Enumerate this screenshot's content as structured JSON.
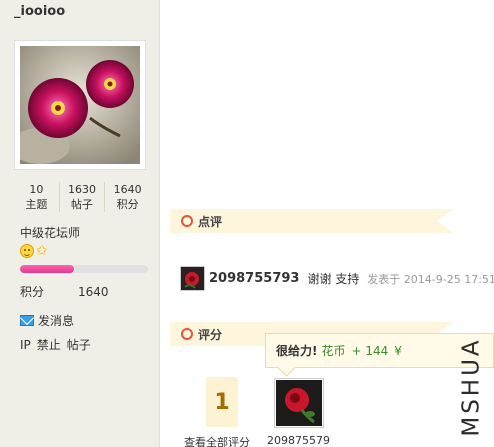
{
  "profile": {
    "username": "_iooioo",
    "stats": [
      {
        "value": "10",
        "label": "主题"
      },
      {
        "value": "1630",
        "label": "帖子"
      },
      {
        "value": "1640",
        "label": "积分"
      }
    ],
    "rank": "中级花坛师",
    "progress_fraction": 0.42,
    "points_label": "积分",
    "points_value": "1640",
    "send_message": "发消息",
    "ip_actions": [
      "IP",
      "禁止",
      "帖子"
    ]
  },
  "sections": {
    "comment_title": "点评",
    "rate_title": "评分"
  },
  "comment": {
    "user": "2098755793",
    "text": "谢谢 支持",
    "time": "发表于 2014-9-25 17:51"
  },
  "rating": {
    "tooltip": {
      "strong": "很给力!",
      "currency": "花币",
      "amount": "+ 144",
      "unit": "¥"
    },
    "count": "1",
    "view_all": "查看全部评分",
    "rater": "209875579"
  },
  "watermark": "MSHUA",
  "colors": {
    "sidebar_bg": "#f0efe7",
    "section_bg": "#fdf6dd",
    "ring": "#e2553d",
    "progress": "#e0378c"
  }
}
